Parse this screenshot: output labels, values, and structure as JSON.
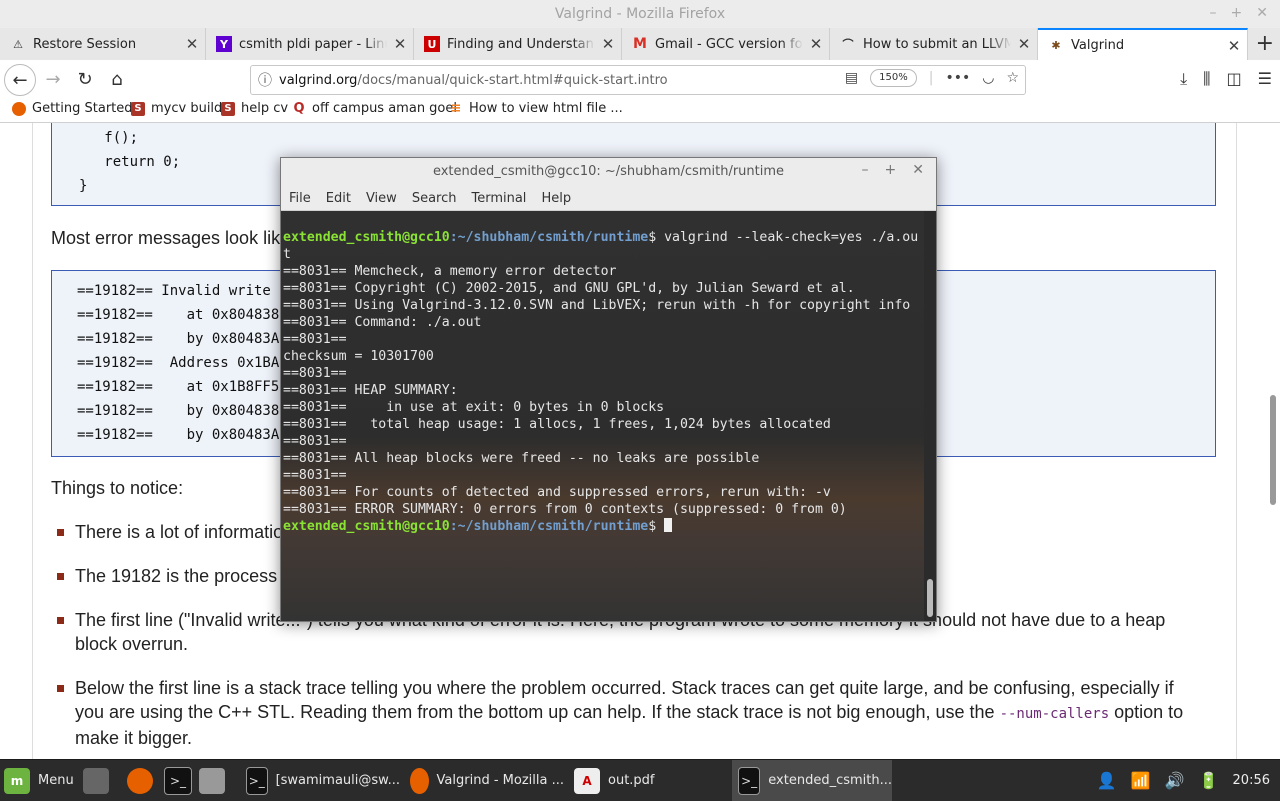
{
  "window": {
    "title": "Valgrind - Mozilla Firefox"
  },
  "tabs": [
    {
      "label": "Restore Session",
      "icon": "warning-icon"
    },
    {
      "label": "csmith pldi paper - LinuxMint",
      "icon": "yahoo-icon"
    },
    {
      "label": "Finding and Understanding Bugs",
      "icon": "utah-icon"
    },
    {
      "label": "Gmail - GCC version for Csmith",
      "icon": "gmail-icon"
    },
    {
      "label": "How to submit an LLVM bug",
      "icon": "llvm-icon"
    },
    {
      "label": "Valgrind",
      "icon": "valgrind-icon"
    }
  ],
  "navbar": {
    "url_domain": "valgrind.org",
    "url_rest": "/docs/manual/quick-start.html#quick-start.intro",
    "zoom": "150%"
  },
  "bookmarks": [
    {
      "label": "Getting Started"
    },
    {
      "label": "mycv build"
    },
    {
      "label": "help cv"
    },
    {
      "label": "off campus aman goel"
    },
    {
      "label": "How to view html file ..."
    }
  ],
  "page": {
    "code1": [
      "   f();",
      "   return 0;",
      "}"
    ],
    "most_error": "Most error messages look like the following, which describes problem 1, the heap block overrun:",
    "code2": [
      "==19182== Invalid write of size 4",
      "==19182==    at 0x804838F: f (example.c:6)",
      "==19182==    by 0x80483AB: main (example.c:11)",
      "==19182==  Address 0x1BA45050 is 0 bytes after a block of size 40 alloc'd",
      "==19182==    at 0x1B8FF5CD: malloc (vg_replace_malloc.c:130)",
      "==19182==    by 0x8048385: f (example.c:5)",
      "==19182==    by 0x80483AB: main (example.c:11)"
    ],
    "things": "Things to notice:",
    "bullets": [
      "There is a lot of information in each error message; read it carefully.",
      "The 19182 is the process ID; it's usually unimportant.",
      "The first line (\"Invalid write...\") tells you what kind of error it is. Here, the program wrote to some memory it should not have due to a heap block overrun.",
      "Below the first line is a stack trace telling you where the problem occurred. Stack traces can get quite large, and be confusing, especially if you are using the C++ STL. Reading them from the bottom up can help. If the stack trace is not big enough, use the"
    ],
    "bullet4_code": "--num-callers",
    "bullet4_tail": " option to make it bigger."
  },
  "terminal": {
    "title": "extended_csmith@gcc10: ~/shubham/csmith/runtime",
    "menu": [
      "File",
      "Edit",
      "View",
      "Search",
      "Terminal",
      "Help"
    ],
    "prompt_user": "extended_csmith@gcc10",
    "prompt_path": ":~/shubham/csmith/runtime",
    "command": "$ valgrind --leak-check=yes ./a.ou",
    "command_wrap": "t",
    "output": [
      "==8031== Memcheck, a memory error detector",
      "==8031== Copyright (C) 2002-2015, and GNU GPL'd, by Julian Seward et al.",
      "==8031== Using Valgrind-3.12.0.SVN and LibVEX; rerun with -h for copyright info",
      "==8031== Command: ./a.out",
      "==8031==",
      "checksum = 10301700",
      "==8031==",
      "==8031== HEAP SUMMARY:",
      "==8031==     in use at exit: 0 bytes in 0 blocks",
      "==8031==   total heap usage: 1 allocs, 1 frees, 1,024 bytes allocated",
      "==8031==",
      "==8031== All heap blocks were freed -- no leaks are possible",
      "==8031==",
      "==8031== For counts of detected and suppressed errors, rerun with: -v",
      "==8031== ERROR SUMMARY: 0 errors from 0 contexts (suppressed: 0 from 0)"
    ],
    "prompt_end": "$ "
  },
  "taskbar": {
    "menu_label": "Menu",
    "items": [
      {
        "label": "[swamimauli@sw..."
      },
      {
        "label": "Valgrind - Mozilla ..."
      },
      {
        "label": "out.pdf"
      },
      {
        "label": "extended_csmith..."
      }
    ],
    "clock": "20:56"
  },
  "colors": {
    "accent": "#0a84ff",
    "prompt_user": "#8ae234",
    "prompt_path": "#729fcf",
    "codebox_border": "#3b5bb5",
    "bullet": "#8b2a17"
  }
}
